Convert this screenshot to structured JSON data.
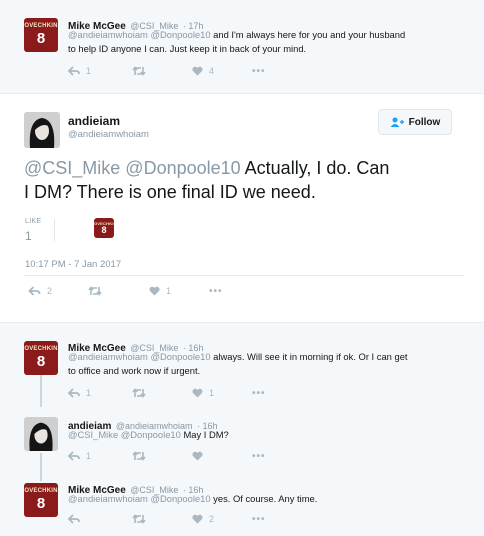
{
  "tweets": [
    {
      "name": "Mike McGee",
      "handle": "@CSI_Mike",
      "time": "17h",
      "mentions": "@andieiamwhoiam @Donpoole10",
      "text": " and I'm always here for you and your husband",
      "text2": "to help ID anyone I can. Just keep it in back of your mind.",
      "reply_count": "1",
      "retweet_count": "",
      "like_count": "4"
    }
  ],
  "focus": {
    "name": "andieiam",
    "handle": "@andieiamwhoiam",
    "follow_label": "Follow",
    "line1_mentions": "@CSI_Mike @Donpoole10",
    "line1_text": "  Actually, I do.  Can",
    "line2_text": "I DM?  There is one final ID we need.",
    "like_label": "LIKE",
    "like_count": "1",
    "timestamp": "10:17 PM - 7 Jan 2017",
    "reply_count": "2",
    "heart_count": "1"
  },
  "replies": [
    {
      "name": "Mike McGee",
      "handle": "@CSI_Mike",
      "time": "16h",
      "mentions": "@andieiamwhoiam @Donpoole10",
      "text": " always. Will see it in morning if ok. Or I can get",
      "text2": "to office and work now if urgent.",
      "reply_count": "1",
      "like_count": "1"
    },
    {
      "name": "andieiam",
      "handle": "@andieiamwhoiam",
      "time": "16h",
      "mentions": "@CSI_Mike @Donpoole10",
      "text": "  May I DM?",
      "reply_count": "1",
      "like_count": ""
    },
    {
      "name": "Mike McGee",
      "handle": "@CSI_Mike",
      "time": "16h",
      "mentions": "@andieiamwhoiam @Donpoole10",
      "text": " yes. Of course. Any time.",
      "reply_count": "",
      "like_count": "2"
    }
  ],
  "jersey": {
    "name": "OVECHKIN",
    "number": "8"
  },
  "colors": {
    "accent": "#1da1f2",
    "muted": "#8899a6",
    "icon": "#aab8c2",
    "jersey": "#8b1a1a"
  }
}
